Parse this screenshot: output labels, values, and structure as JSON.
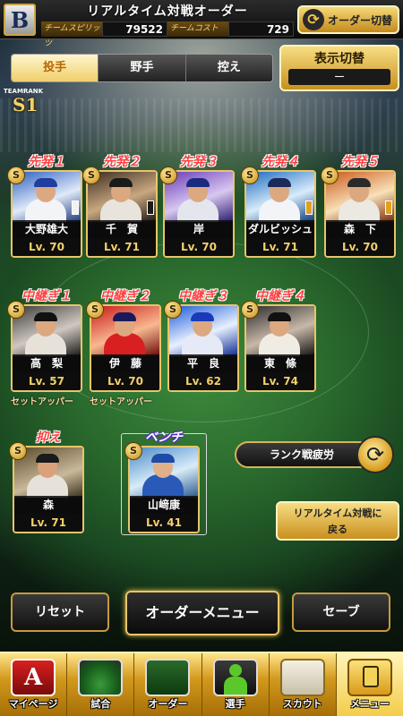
{
  "header": {
    "team_logo": "B",
    "title": "リアルタイム対戦オーダー",
    "team_spirit_label": "チームスピリッツ",
    "team_spirit_value": "79522",
    "team_cost_label": "チームコスト",
    "team_cost_value": "729",
    "order_switch_label": "オーダー切替"
  },
  "tabs": [
    {
      "label": "投手",
      "active": true
    },
    {
      "label": "野手",
      "active": false
    },
    {
      "label": "控え",
      "active": false
    }
  ],
  "display_toggle": {
    "label": "表示切替",
    "value": "ー"
  },
  "team_rank": {
    "label": "TEAMRANK",
    "value": "S1"
  },
  "starters": [
    {
      "slot": "先発１",
      "name": "大野雄大",
      "level": "Lv. 70"
    },
    {
      "slot": "先発２",
      "name": "千　賀",
      "level": "Lv. 71"
    },
    {
      "slot": "先発３",
      "name": "岸",
      "level": "Lv. 70"
    },
    {
      "slot": "先発４",
      "name": "ダルビッシュ",
      "level": "Lv. 71"
    },
    {
      "slot": "先発５",
      "name": "森　下",
      "level": "Lv. 70"
    }
  ],
  "relievers": [
    {
      "slot": "中継ぎ１",
      "name": "高　梨",
      "level": "Lv. 57",
      "sub": "セットアッパー"
    },
    {
      "slot": "中継ぎ２",
      "name": "伊　藤",
      "level": "Lv. 70",
      "sub": "セットアッパー"
    },
    {
      "slot": "中継ぎ３",
      "name": "平　良",
      "level": "Lv. 62",
      "sub": ""
    },
    {
      "slot": "中継ぎ４",
      "name": "東　條",
      "level": "Lv. 74",
      "sub": ""
    }
  ],
  "closer": {
    "slot": "抑え",
    "name": "森",
    "level": "Lv. 71"
  },
  "bench": {
    "slot": "ベンチ",
    "name": "山﨑康",
    "level": "Lv. 41"
  },
  "rank_fatigue_label": "ランク戦疲労",
  "back_button_label": "リアルタイム対戦に戻る",
  "back_button_line1": "リアルタイム対戦に",
  "back_button_line2": "戻る",
  "bottom": {
    "reset": "リセット",
    "menu": "オーダーメニュー",
    "save": "セーブ"
  },
  "badge": "S",
  "nav": [
    {
      "label": "マイページ",
      "icon": "mypage-icon"
    },
    {
      "label": "試合",
      "icon": "stadium-icon"
    },
    {
      "label": "オーダー",
      "icon": "order-icon"
    },
    {
      "label": "選手",
      "icon": "player-icon"
    },
    {
      "label": "スカウト",
      "icon": "scout-icon"
    },
    {
      "label": "メニュー",
      "icon": "menu-icon"
    }
  ],
  "colors": {
    "accent": "#f2c94c",
    "slot_title": "#ff4040",
    "level": "#f2d06b"
  }
}
